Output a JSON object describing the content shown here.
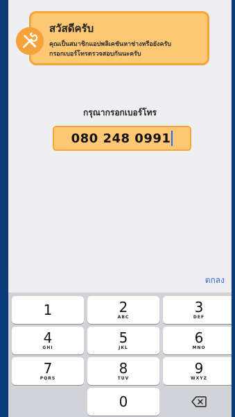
{
  "banner": {
    "icon": "tools-icon",
    "title": "สวัสดีครับ",
    "line1": "คุณเป็นสมาชิกแอปพลิเคชันหาช่างหรือยังครับ",
    "line2": "กรอกเบอร์โทรตรวจสอบกันนะครับ"
  },
  "form": {
    "prompt": "กรุณากรอกเบอร์โทร",
    "phone_value": "080 248 0991"
  },
  "keyboard": {
    "done_label": "ตกลง",
    "keys": [
      {
        "num": "1",
        "sub": ""
      },
      {
        "num": "2",
        "sub": "ABC"
      },
      {
        "num": "3",
        "sub": "DEF"
      },
      {
        "num": "4",
        "sub": "GHI"
      },
      {
        "num": "5",
        "sub": "JKL"
      },
      {
        "num": "6",
        "sub": "MNO"
      },
      {
        "num": "7",
        "sub": "PQRS"
      },
      {
        "num": "8",
        "sub": "TUV"
      },
      {
        "num": "9",
        "sub": "WXYZ"
      },
      {
        "num": "0",
        "sub": ""
      }
    ],
    "delete_icon": "backspace-icon"
  },
  "colors": {
    "background": "#0a3a78",
    "banner_fill": "#fdc774",
    "banner_border": "#f6a53a",
    "accent": "#3366dd"
  }
}
